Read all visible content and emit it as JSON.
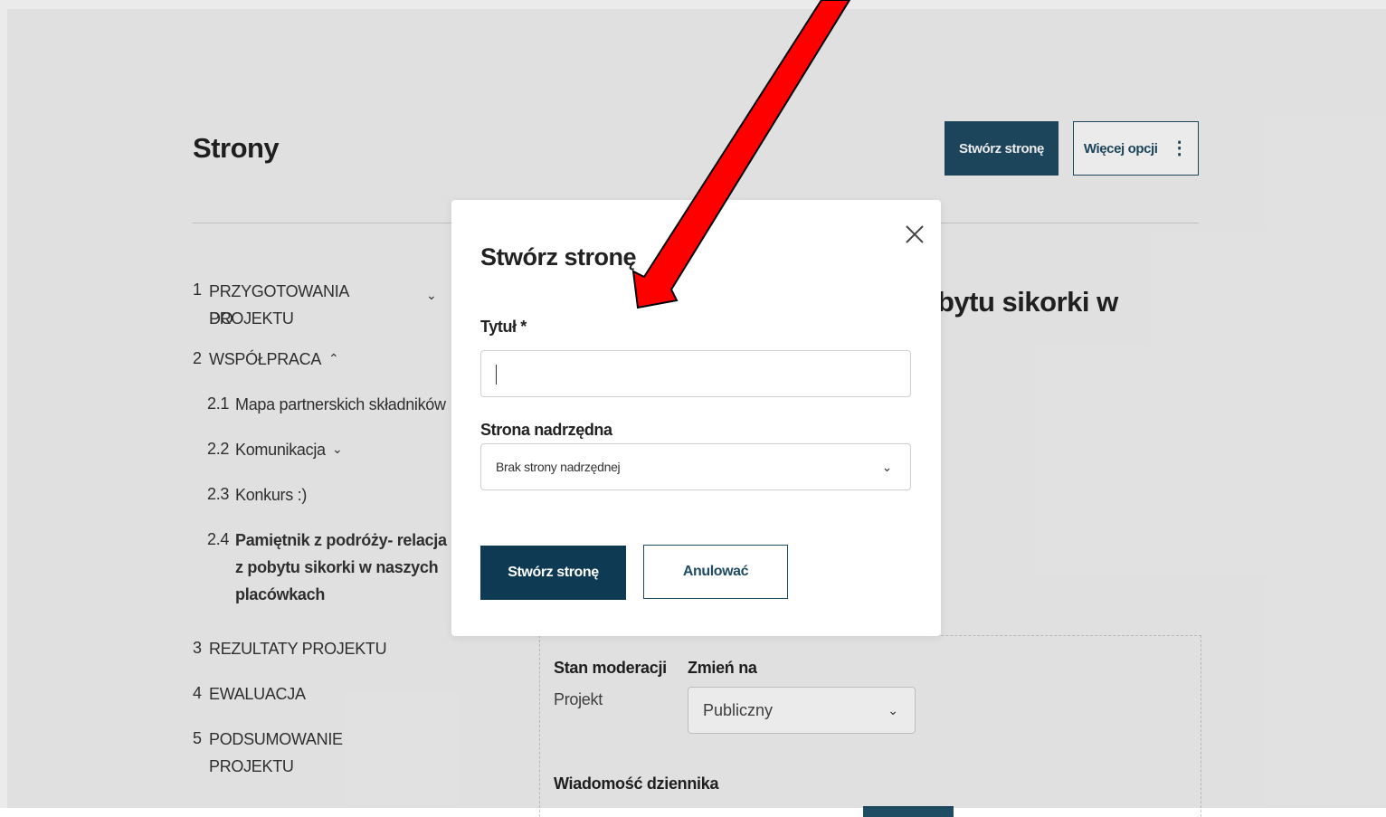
{
  "page": {
    "title": "Strony",
    "create_button": "Stwórz stronę",
    "more_options_button": "Więcej opcji",
    "content_heading_fragment": "bytu sikorki w"
  },
  "toc": [
    {
      "num": "1",
      "label_line1": "PRZYGOTOWANIA DO",
      "label_line2": "PROJEKTU",
      "icon": "chevron-down-icon"
    },
    {
      "num": "2",
      "label": "WSPÓŁPRACA",
      "icon": "chevron-up-icon"
    },
    {
      "num": "2.1",
      "label": "Mapa partnerskich składników"
    },
    {
      "num": "2.2",
      "label": "Komunikacja",
      "icon": "chevron-down-icon"
    },
    {
      "num": "2.3",
      "label": "Konkurs :)"
    },
    {
      "num": "2.4",
      "label_line1": "Pamiętnik z podróży- relacja",
      "label_line2": "z pobytu sikorki w naszych",
      "label_line3": "placówkach",
      "active": true
    },
    {
      "num": "3",
      "label": "REZULTATY PROJEKTU"
    },
    {
      "num": "4",
      "label": "EWALUACJA"
    },
    {
      "num": "5",
      "label_line1": "PODSUMOWANIE",
      "label_line2": "PROJEKTU"
    }
  ],
  "moderation": {
    "state_label": "Stan moderacji",
    "state_value": "Projekt",
    "change_label": "Zmień na",
    "change_value": "Publiczny",
    "log_label": "Wiadomość dziennika"
  },
  "modal": {
    "title": "Stwórz stronę",
    "title_field_label": "Tytuł *",
    "title_field_value": "",
    "parent_label": "Strona nadrzędna",
    "parent_value": "Brak strony nadrzędnej",
    "create_button": "Stwórz stronę",
    "cancel_button": "Anulować"
  },
  "annotation": {
    "color": "#ff0000",
    "icon": "red-arrow"
  },
  "colors": {
    "primary": "#1f4b63",
    "primary_dark": "#0f3a54"
  }
}
